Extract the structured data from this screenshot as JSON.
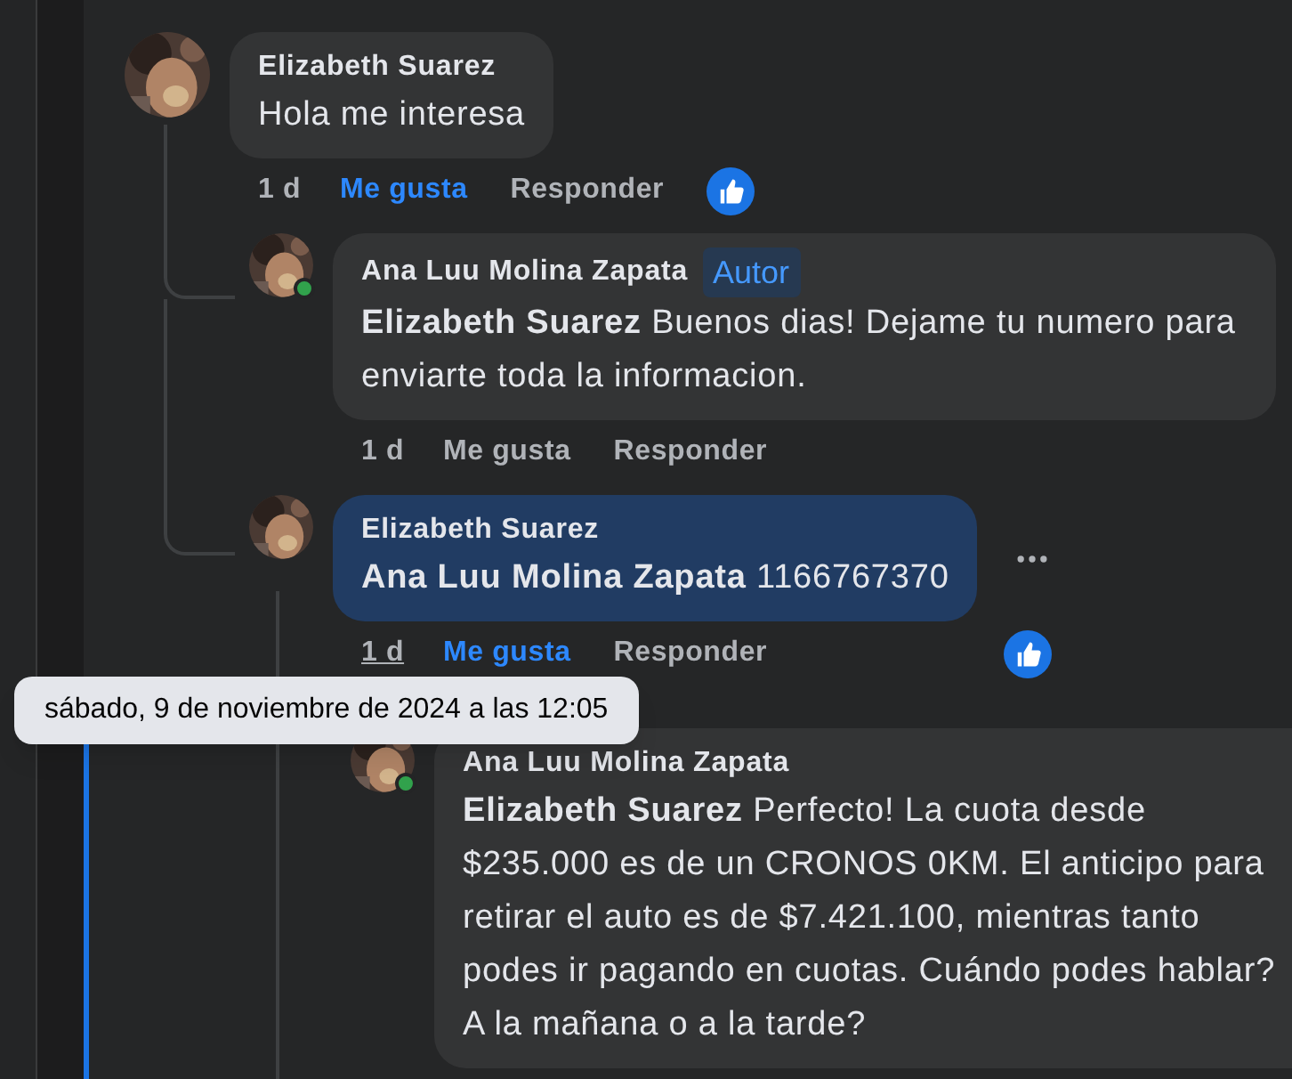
{
  "comments": [
    {
      "author": "Elizabeth Suarez",
      "text": "Hola me interesa",
      "time": "1 d",
      "time_hovered": false,
      "like_label": "Me gusta",
      "liked": true,
      "reply_label": "Responder",
      "reaction": true,
      "highlighted": false,
      "online": false,
      "children": [
        {
          "author": "Ana Luu Molina Zapata",
          "author_badge": "Autor",
          "text": "**Elizabeth Suarez** Buenos dias! Dejame tu numero para enviarte toda la informacion.",
          "time": "1 d",
          "time_hovered": false,
          "like_label": "Me gusta",
          "liked": false,
          "reply_label": "Responder",
          "highlighted": false,
          "online": true
        },
        {
          "author": "Elizabeth Suarez",
          "text": "**Ana Luu Molina Zapata** 1166767370",
          "time": "1 d",
          "time_hovered": true,
          "like_label": "Me gusta",
          "liked": true,
          "reply_label": "Responder",
          "reaction": true,
          "highlighted": true,
          "online": false,
          "more_menu": true,
          "children": [
            {
              "author": "Ana Luu Molina Zapata",
              "text": "**Elizabeth Suarez** Perfecto! La cuota desde $235.000 es de un CRONOS 0KM. El anticipo para retirar el auto es de $7.421.100, mientras tanto podes ir pagando en cuotas. Cuándo podes hablar? A la mañana o a la tarde?",
              "highlighted": false,
              "online": true
            }
          ]
        }
      ]
    }
  ],
  "tooltip": "sábado, 9 de noviembre de 2024 a las 12:05"
}
